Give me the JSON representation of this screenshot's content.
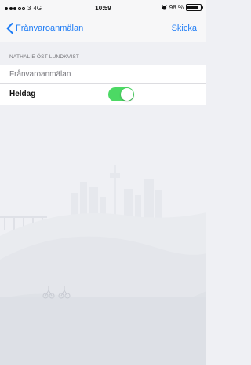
{
  "status_bar": {
    "carrier": "3",
    "network": "4G",
    "time": "10:59",
    "battery_text": "98 %",
    "signal_bars_filled": 3,
    "signal_bars_total": 5,
    "battery_level": 0.98
  },
  "nav": {
    "back_label": "Frånvaroanmälan",
    "action_label": "Skicka",
    "accent_color": "#1e7cf5"
  },
  "form": {
    "section_header": "NATHALIE ÖST LUNDKVIST",
    "title_placeholder": "Frånvaroanmälan",
    "allday_label": "Heldag",
    "allday_on": true,
    "toggle_color": "#4cd964"
  },
  "icons": {
    "back": "chevron-left-icon",
    "alarm": "alarm-icon",
    "battery": "battery-icon"
  }
}
